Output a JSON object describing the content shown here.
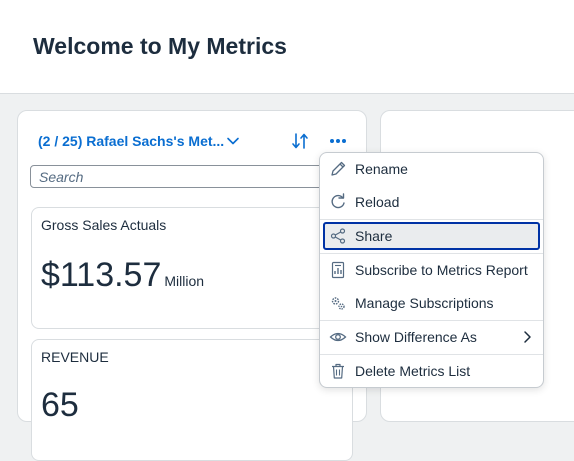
{
  "header": {
    "title": "Welcome to My Metrics"
  },
  "list": {
    "title": "(2 / 25) Rafael Sachs's Met...",
    "search_placeholder": "Search"
  },
  "tiles": [
    {
      "title": "Gross Sales Actuals",
      "value": "$113.57",
      "unit": "Million"
    },
    {
      "title": "REVENUE",
      "value": "65",
      "unit": ""
    }
  ],
  "menu": {
    "items": [
      {
        "label": "Rename",
        "icon": "pencil-icon"
      },
      {
        "label": "Reload",
        "icon": "refresh-icon"
      },
      {
        "label": "Share",
        "icon": "share-icon",
        "focused": true
      },
      {
        "label": "Subscribe to Metrics Report",
        "icon": "report-icon"
      },
      {
        "label": "Manage Subscriptions",
        "icon": "gears-icon"
      },
      {
        "label": "Show Difference As",
        "icon": "eye-icon",
        "submenu": true
      },
      {
        "label": "Delete Metrics List",
        "icon": "trash-icon"
      }
    ]
  },
  "colors": {
    "accent": "#0a6ed1",
    "focus_border": "#0032a5",
    "text": "#1d2d3e"
  }
}
